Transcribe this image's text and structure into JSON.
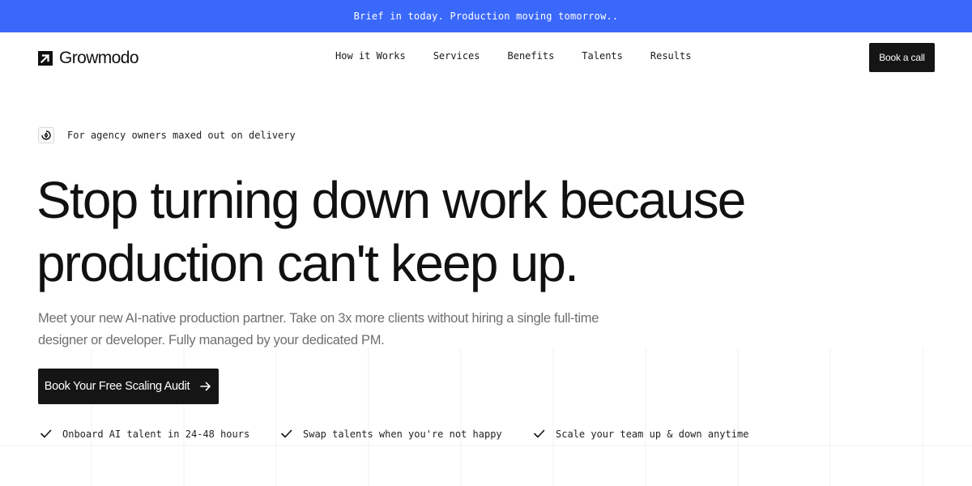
{
  "announcement": {
    "text": "Brief in today. Production moving tomorrow.."
  },
  "header": {
    "logo_text": "Growmodo",
    "nav": [
      {
        "label": "How it Works"
      },
      {
        "label": "Services"
      },
      {
        "label": "Benefits"
      },
      {
        "label": "Talents"
      },
      {
        "label": "Results"
      }
    ],
    "cta_label": "Book a call"
  },
  "hero": {
    "tagline": "For agency owners maxed out on delivery",
    "tagline_icon": "spark-icon",
    "headline_line1": "Stop turning down work because",
    "headline_line2": "production can't keep up.",
    "subtitle_line1": "Meet your new AI-native production partner. Take on 3x more clients without hiring a single full-time",
    "subtitle_line2": "designer or developer. Fully managed by your dedicated PM.",
    "cta_label": "Book Your Free Scaling Audit",
    "cta_icon": "arrow-right-icon",
    "features": [
      {
        "text": "Onboard AI talent in 24-48 hours",
        "icon": "check-icon"
      },
      {
        "text": "Swap talents when you're not happy",
        "icon": "check-icon"
      },
      {
        "text": "Scale your team up & down anytime",
        "icon": "check-icon"
      }
    ]
  },
  "colors": {
    "announcement_bg": "#3a68fb",
    "text_primary": "#111111",
    "text_muted": "#6f6f6f",
    "button_bg": "#151515",
    "button_text": "#ffffff"
  }
}
